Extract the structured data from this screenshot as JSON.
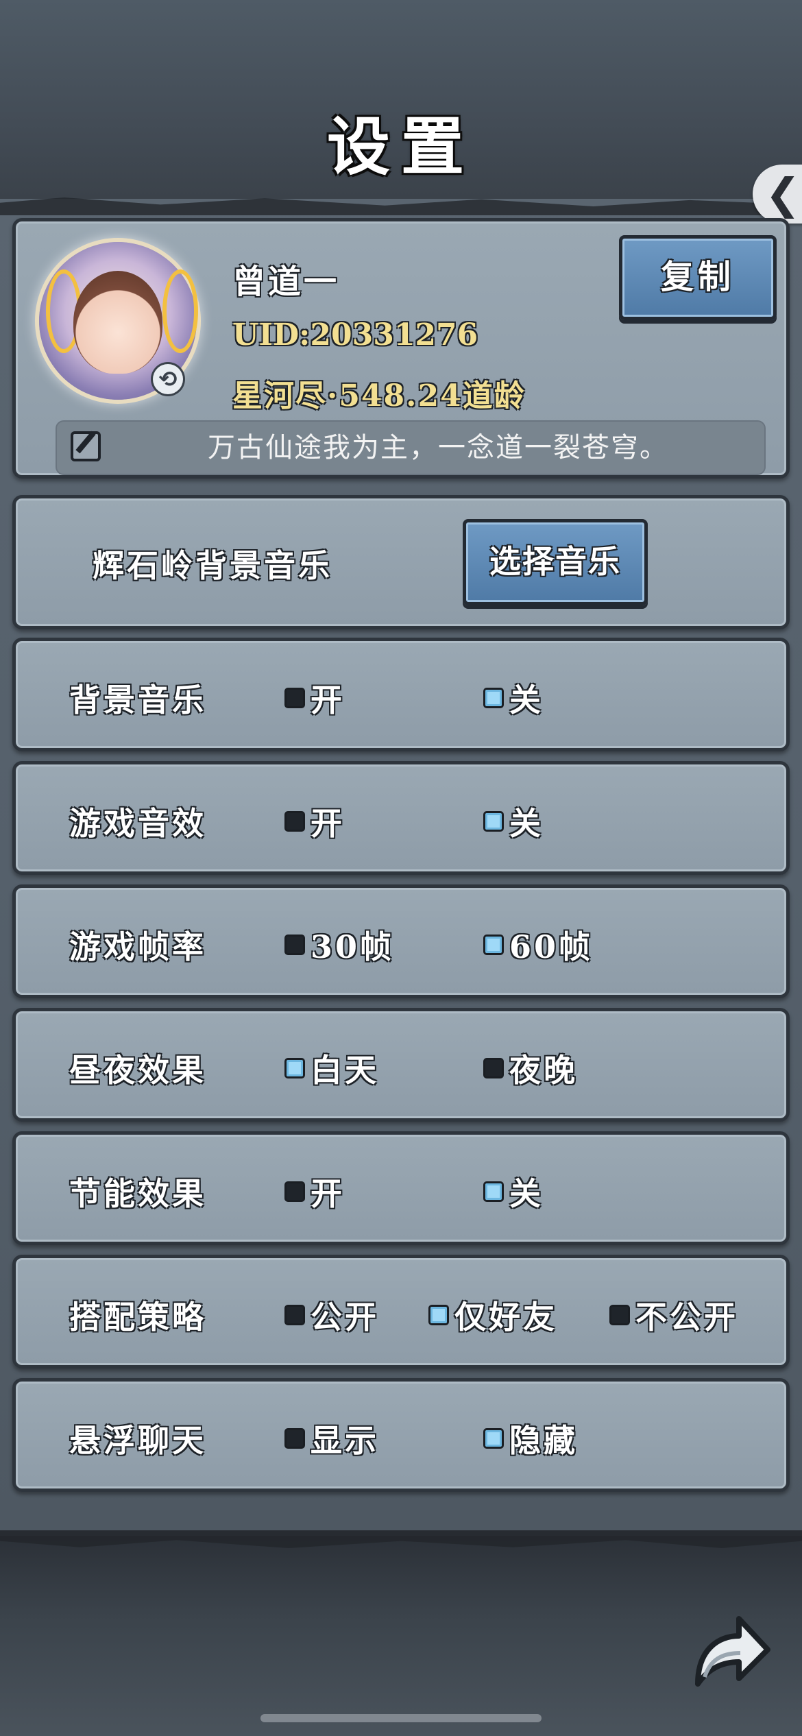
{
  "header": {
    "title": "设置"
  },
  "profile": {
    "name": "曾道一",
    "uid": "UID:20331276",
    "realm": "星河尽·548.24道龄",
    "copy_label": "复制",
    "signature": "万古仙途我为主，一念道一裂苍穹。"
  },
  "music_select": {
    "label": "辉石岭背景音乐",
    "button_label": "选择音乐"
  },
  "settings": [
    {
      "label": "背景音乐",
      "options": [
        {
          "label": "开",
          "selected": false
        },
        {
          "label": "关",
          "selected": true
        }
      ]
    },
    {
      "label": "游戏音效",
      "options": [
        {
          "label": "开",
          "selected": false
        },
        {
          "label": "关",
          "selected": true
        }
      ]
    },
    {
      "label": "游戏帧率",
      "options": [
        {
          "label": "30帧",
          "selected": false
        },
        {
          "label": "60帧",
          "selected": true
        }
      ]
    },
    {
      "label": "昼夜效果",
      "options": [
        {
          "label": "白天",
          "selected": true
        },
        {
          "label": "夜晚",
          "selected": false
        }
      ]
    },
    {
      "label": "节能效果",
      "options": [
        {
          "label": "开",
          "selected": false
        },
        {
          "label": "关",
          "selected": true
        }
      ]
    },
    {
      "label": "搭配策略",
      "options": [
        {
          "label": "公开",
          "selected": false
        },
        {
          "label": "仅好友",
          "selected": true
        },
        {
          "label": "不公开",
          "selected": false
        }
      ]
    },
    {
      "label": "悬浮聊天",
      "options": [
        {
          "label": "显示",
          "selected": false
        },
        {
          "label": "隐藏",
          "selected": true
        }
      ]
    }
  ],
  "icons": {
    "back": "chevron-left-icon",
    "edit": "edit-icon",
    "refresh": "refresh-icon",
    "share": "share-arrow-icon"
  },
  "colors": {
    "selected": "#9fd9f7",
    "unselected": "#1f242a",
    "button": "#5a86b2",
    "panel": "#95a3ae",
    "realm_text": "#f2df92"
  }
}
